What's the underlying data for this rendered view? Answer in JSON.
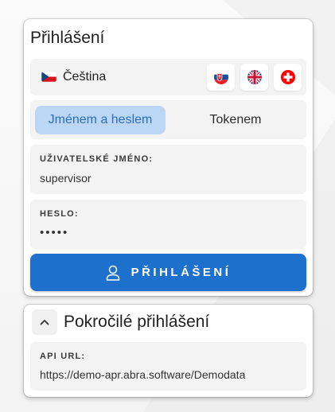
{
  "login": {
    "title": "Přihlášení",
    "language": {
      "label": "Čeština",
      "current_flag": "flag-cz-icon",
      "options": [
        "flag-sk-icon",
        "flag-gb-icon",
        "flag-ch-icon"
      ]
    },
    "methods": [
      {
        "label": "Jménem a heslem",
        "active": true
      },
      {
        "label": "Tokenem",
        "active": false
      }
    ],
    "username": {
      "label": "UŽIVATELSKÉ JMÉNO:",
      "value": "supervisor"
    },
    "password": {
      "label": "HESLO:",
      "value": "•••••"
    },
    "submit": {
      "label": "PŘIHLÁŠENÍ",
      "icon": "user-icon"
    }
  },
  "advanced": {
    "title": "Pokročilé přihlášení",
    "toggle_icon": "chevron-up-icon",
    "api_url": {
      "label": "API URL:",
      "value": "https://demo-apr.abra.software/Demodata"
    }
  },
  "colors": {
    "primary": "#1e70cd",
    "tab_active_bg": "#bcd7f5",
    "tab_active_text": "#2a6fb8",
    "panel_bg": "#f3f3f3"
  }
}
